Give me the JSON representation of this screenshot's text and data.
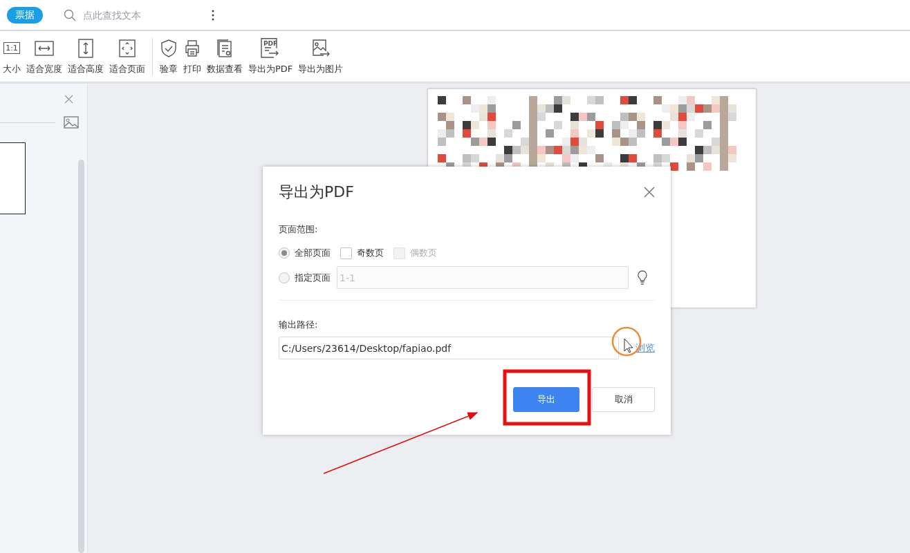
{
  "search_bar": {
    "tag": "票据",
    "placeholder": "点此查找文本"
  },
  "toolbar": {
    "groups": [
      [
        {
          "kind": "actual-size",
          "label": "大小",
          "icon_text": "1:1"
        },
        {
          "kind": "fit-width",
          "label": "适合宽度"
        },
        {
          "kind": "fit-height",
          "label": "适合高度"
        },
        {
          "kind": "fit-page",
          "label": "适合页面"
        }
      ],
      [
        {
          "kind": "verify",
          "label": "验章"
        },
        {
          "kind": "print",
          "label": "打印"
        },
        {
          "kind": "data-view",
          "label": "数据查看"
        },
        {
          "kind": "export-pdf",
          "label": "导出为PDF",
          "icon_text": "PDF"
        },
        {
          "kind": "export-image",
          "label": "导出为图片"
        }
      ]
    ]
  },
  "dialog": {
    "title": "导出为PDF",
    "page_range": {
      "label": "页面范围:",
      "options": [
        {
          "kind": "radio",
          "label": "全部页面",
          "selected": true
        },
        {
          "kind": "checkbox",
          "label": "奇数页",
          "checked": false,
          "disabled": false
        },
        {
          "kind": "checkbox",
          "label": "偶数页",
          "checked": false,
          "disabled": true
        },
        {
          "kind": "radio",
          "label": "指定页面",
          "selected": false
        }
      ],
      "custom_field": {
        "value": "1-1",
        "disabled": true
      }
    },
    "output": {
      "label": "输出路径:",
      "path": "C:/Users/23614/Desktop/fapiao.pdf",
      "browse": "浏览"
    },
    "buttons": [
      {
        "kind": "primary",
        "label": "导出"
      },
      {
        "kind": "default",
        "label": "取消"
      }
    ]
  }
}
